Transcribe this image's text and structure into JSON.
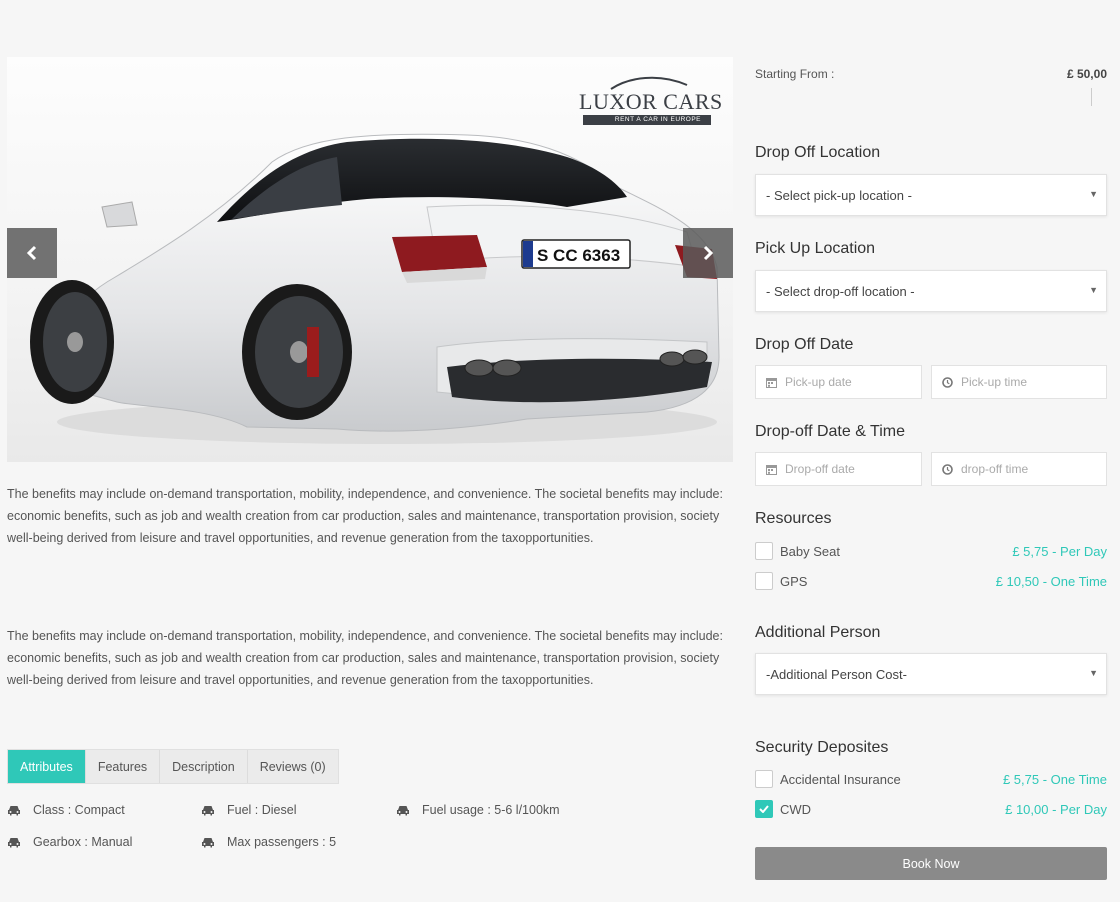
{
  "gallery": {
    "logo_text": "LUXOR CARS",
    "logo_tagline": "RENT A CAR IN EUROPE",
    "plate": "S CC 6363",
    "prev_icon": "chevron-left-icon",
    "next_icon": "chevron-right-icon"
  },
  "description": {
    "paragraph_1": "The benefits may include on-demand transportation, mobility, independence, and convenience. The societal benefits may include: economic benefits, such as job and wealth creation from car production, sales and maintenance, transportation provision, society well-being derived from leisure and travel opportunities, and revenue generation from the taxopportunities.",
    "paragraph_2": "The benefits may include on-demand transportation, mobility, independence, and convenience. The societal benefits may include: economic benefits, such as job and wealth creation from car production, sales and maintenance, transportation provision, society well-being derived from leisure and travel opportunities, and revenue generation from the taxopportunities."
  },
  "tabs": [
    {
      "label": "Attributes",
      "active": true
    },
    {
      "label": "Features",
      "active": false
    },
    {
      "label": "Description",
      "active": false
    },
    {
      "label": "Reviews (0)",
      "active": false
    }
  ],
  "attributes": [
    {
      "label": "Class : Compact",
      "icon": "car-icon"
    },
    {
      "label": "Fuel : Diesel",
      "icon": "car-icon"
    },
    {
      "label": "Fuel usage : 5-6 l/100km",
      "icon": "car-icon"
    },
    {
      "label": "Gearbox : Manual",
      "icon": "car-icon"
    },
    {
      "label": "Max passengers : 5",
      "icon": "car-icon"
    }
  ],
  "booking": {
    "starting_from_label": "Starting From :",
    "starting_price": "£ 50,00",
    "drop_off_location_heading": "Drop Off Location",
    "drop_off_location_select": "- Select pick-up location -",
    "pick_up_location_heading": "Pick Up Location",
    "pick_up_location_select": "- Select drop-off location -",
    "drop_off_date_heading": "Drop Off Date",
    "pickup_date_placeholder": "Pick-up date",
    "pickup_time_placeholder": "Pick-up time",
    "drop_off_datetime_heading": "Drop-off Date & Time",
    "dropoff_date_placeholder": "Drop-off date",
    "dropoff_time_placeholder": "drop-off time",
    "resources_heading": "Resources",
    "resources": [
      {
        "label": "Baby Seat",
        "price": "£ 5,75 - Per Day",
        "checked": false
      },
      {
        "label": "GPS",
        "price": "£ 10,50 - One Time",
        "checked": false
      }
    ],
    "additional_person_heading": "Additional Person",
    "additional_person_select": "-Additional Person Cost-",
    "security_heading": "Security Deposites",
    "security": [
      {
        "label": "Accidental Insurance",
        "price": "£ 5,75 - One Time",
        "checked": false
      },
      {
        "label": "CWD",
        "price": "£ 10,00 - Per Day",
        "checked": true
      }
    ],
    "book_label": "Book Now"
  },
  "colors": {
    "accent": "#2fc8b8",
    "book_button": "#8a8a8a",
    "background": "#f6f6f6"
  }
}
